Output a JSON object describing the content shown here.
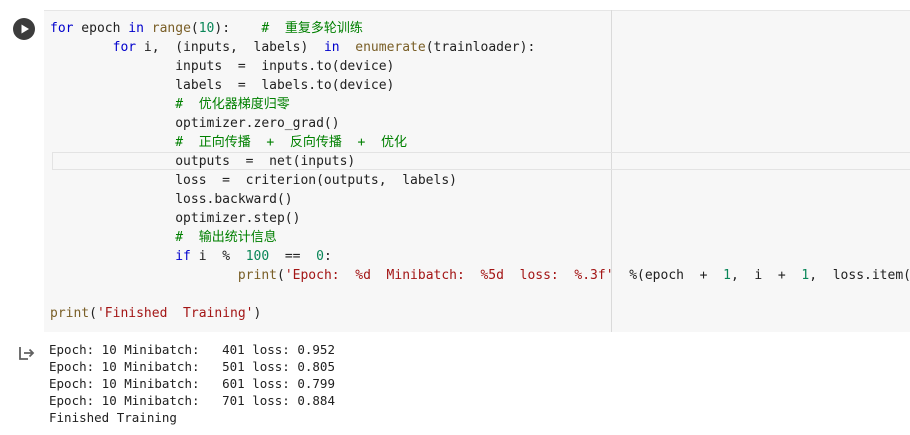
{
  "code": {
    "line1": [
      "for",
      " epoch ",
      "in",
      " ",
      "range",
      "(",
      "10",
      "):    ",
      "#  重复多轮训练"
    ],
    "line2": [
      "        ",
      "for",
      " i,  (inputs,  labels)  ",
      "in",
      "  ",
      "enumerate",
      "(trainloader):"
    ],
    "line3": "                inputs  =  inputs.to(device)",
    "line4": "                labels  =  labels.to(device)",
    "line5": "                #  优化器梯度归零",
    "line6": "                optimizer.zero_grad()",
    "line7": "                #  正向传播  +  反向传播  +  优化",
    "line8": "                outputs  =  net(inputs)",
    "line9": "                loss  =  criterion(outputs,  labels)",
    "line10": "                loss.backward()",
    "line11": "                optimizer.step()",
    "line12": "                #  输出统计信息",
    "line13": [
      "                ",
      "if",
      " i  %  ",
      "100",
      "  ==  ",
      "0",
      ":"
    ],
    "line14": [
      "                        ",
      "print",
      "(",
      "'Epoch:  %d  Minibatch:  %5d  loss:  %.3f'",
      "  %(epoch  +  ",
      "1",
      ",  i  +  ",
      "1",
      ",  loss.item()))"
    ],
    "line15": [
      "print",
      "(",
      "'Finished  Training'",
      ")"
    ]
  },
  "output": {
    "lines": [
      "Epoch: 10 Minibatch:   401 loss: 0.952",
      "Epoch: 10 Minibatch:   501 loss: 0.805",
      "Epoch: 10 Minibatch:   601 loss: 0.799",
      "Epoch: 10 Minibatch:   701 loss: 0.884",
      "Finished Training"
    ]
  },
  "colors": {
    "keyword": "#0000cc",
    "builtin": "#795e26",
    "number": "#098658",
    "string": "#a31515",
    "comment": "#008000",
    "code_background": "#f7f7f7"
  },
  "icons": {
    "run": "play-circle-icon",
    "output": "output-redirect-icon"
  }
}
